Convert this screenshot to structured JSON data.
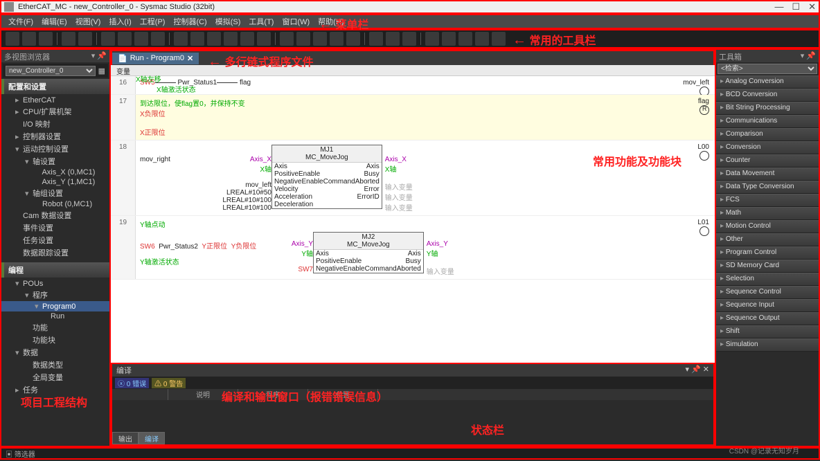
{
  "title": "EtherCAT_MC - new_Controller_0 - Sysmac Studio (32bit)",
  "menus": [
    "文件(F)",
    "编辑(E)",
    "视图(V)",
    "插入(I)",
    "工程(P)",
    "控制器(C)",
    "模拟(S)",
    "工具(T)",
    "窗口(W)",
    "帮助(H)"
  ],
  "left": {
    "header": "多视图浏览器",
    "selector": "new_Controller_0",
    "section1": "配置和设置",
    "tree1": [
      {
        "t": "EtherCAT",
        "l": 2,
        "a": "▸"
      },
      {
        "t": "CPU/扩展机架",
        "l": 2,
        "a": "▸"
      },
      {
        "t": "I/O 映射",
        "l": 2,
        "a": ""
      },
      {
        "t": "控制器设置",
        "l": 2,
        "a": "▸"
      },
      {
        "t": "运动控制设置",
        "l": 2,
        "a": "▾"
      },
      {
        "t": "轴设置",
        "l": 3,
        "a": "▾"
      },
      {
        "t": "Axis_X (0,MC1)",
        "l": 4,
        "a": ""
      },
      {
        "t": "Axis_Y (1,MC1)",
        "l": 4,
        "a": ""
      },
      {
        "t": "轴组设置",
        "l": 3,
        "a": "▾"
      },
      {
        "t": "Robot (0,MC1)",
        "l": 4,
        "a": ""
      },
      {
        "t": "Cam 数据设置",
        "l": 2,
        "a": ""
      },
      {
        "t": "事件设置",
        "l": 2,
        "a": ""
      },
      {
        "t": "任务设置",
        "l": 2,
        "a": ""
      },
      {
        "t": "数据跟踪设置",
        "l": 2,
        "a": ""
      }
    ],
    "section2": "编程",
    "tree2": [
      {
        "t": "POUs",
        "l": 2,
        "a": "▾"
      },
      {
        "t": "程序",
        "l": 3,
        "a": "▾"
      },
      {
        "t": "Program0",
        "l": 4,
        "a": "▾",
        "sel": true
      },
      {
        "t": "Run",
        "l": 5,
        "a": ""
      },
      {
        "t": "功能",
        "l": 3,
        "a": ""
      },
      {
        "t": "功能块",
        "l": 3,
        "a": ""
      },
      {
        "t": "数据",
        "l": 2,
        "a": "▾"
      },
      {
        "t": "数据类型",
        "l": 3,
        "a": ""
      },
      {
        "t": "全局变量",
        "l": 3,
        "a": ""
      },
      {
        "t": "任务",
        "l": 2,
        "a": "▸"
      }
    ]
  },
  "tab": {
    "icon": "📄",
    "label": "Run - Program0",
    "close": "✕"
  },
  "canvas": {
    "header": "变量",
    "r16": {
      "num": "16",
      "sw": "SW5",
      "pwr": "Pwr_Status1",
      "flag": "flag",
      "xact": "X轴激活状态",
      "out": "mov_left",
      "title_above": "X轴左移"
    },
    "r17": {
      "num": "17",
      "cmt": "到达限位，使flag置0，并保持不变",
      "xneg": "X负限位",
      "xpos": "X正限位",
      "out": "flag",
      "coil": "R"
    },
    "r18": {
      "num": "18",
      "right_var": "mov_right",
      "fb": "MJ1",
      "fbtype": "MC_MoveJog",
      "axisL": "Axis_X",
      "axisLg": "X轴",
      "axisR": "Axis_X",
      "axisRg": "X轴",
      "ports": [
        [
          "Axis",
          "Axis"
        ],
        [
          "PositiveEnable",
          "Busy"
        ],
        [
          "NegativeEnable",
          "CommandAborted"
        ],
        [
          "Velocity",
          "Error"
        ],
        [
          "Acceleration",
          "ErrorID"
        ],
        [
          "Deceleration",
          ""
        ]
      ],
      "lval": [
        "",
        "",
        "mov_left",
        "LREAL#10#50",
        "LREAL#10#100",
        "LREAL#10#100"
      ],
      "rval": [
        "",
        "",
        "输入变量",
        "输入变量",
        "输入变量",
        ""
      ],
      "out": "L00"
    },
    "r19": {
      "num": "19",
      "cmt": "Y轴点动",
      "sw": "SW6",
      "pwr": "Pwr_Status2",
      "ypos": "Y正限位",
      "yneg": "Y负限位",
      "yact": "Y轴激活状态",
      "fb": "MJ2",
      "fbtype": "MC_MoveJog",
      "axisL": "Axis_Y",
      "axisLg": "Y轴",
      "axisR": "Axis_Y",
      "axisRg": "Y轴",
      "ports": [
        [
          "Axis",
          "Axis"
        ],
        [
          "PositiveEnable",
          "Busy"
        ],
        [
          "NegativeEnable",
          "CommandAborted"
        ]
      ],
      "sw7": "SW7",
      "out": "L01",
      "rval": "输入变量"
    }
  },
  "bottom": {
    "title": "编译",
    "err": "0 错误",
    "warn": "0 警告",
    "cols": [
      "",
      "说明",
      "程序",
      "位置"
    ],
    "tabs": [
      "输出",
      "编译"
    ]
  },
  "right": {
    "header": "工具箱",
    "search": "<检索>",
    "items": [
      "Analog Conversion",
      "BCD Conversion",
      "Bit String Processing",
      "Communications",
      "Comparison",
      "Conversion",
      "Counter",
      "Data Movement",
      "Data Type Conversion",
      "FCS",
      "Math",
      "Motion Control",
      "Other",
      "Program Control",
      "SD Memory Card",
      "Selection",
      "Sequence Control",
      "Sequence Input",
      "Sequence Output",
      "Shift",
      "Simulation"
    ]
  },
  "status": {
    "filter": "▣ 筛选器"
  },
  "anno": {
    "menu": "菜单栏",
    "tool": "常用的工具栏",
    "tab": "多行链式程序文件",
    "func": "常用功能及功能块",
    "proj": "项目工程结构",
    "comp": "编译和输出窗口（报错错误信息）",
    "stat": "状态栏"
  },
  "watermark": "CSDN @记录无知岁月"
}
